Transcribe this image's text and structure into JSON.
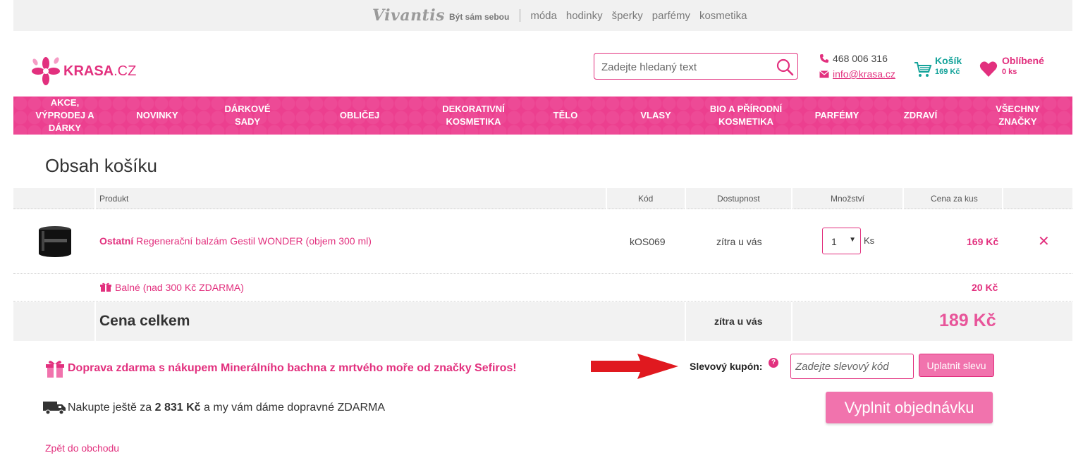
{
  "topbar": {
    "brand": "Vivantis",
    "slogan": "Být sám sebou",
    "links": [
      "móda",
      "hodinky",
      "šperky",
      "parfémy",
      "kosmetika"
    ]
  },
  "header": {
    "logo_main": "KRASA",
    "logo_tld": ".CZ",
    "search_placeholder": "Zadejte hledaný text",
    "phone": "468 006 316",
    "email": "info@krasa.cz",
    "cart_label": "Košík",
    "cart_total": "169 Kč",
    "fav_label": "Oblíbené",
    "fav_count": "0 ks"
  },
  "nav": [
    "AKCE, VÝPRODEJ A DÁRKY",
    "NOVINKY",
    "DÁRKOVÉ SADY",
    "OBLIČEJ",
    "DEKORATIVNÍ KOSMETIKA",
    "TĚLO",
    "VLASY",
    "BIO A PŘÍRODNÍ KOSMETIKA",
    "PARFÉMY",
    "ZDRAVÍ",
    "VŠECHNY ZNAČKY"
  ],
  "page_title": "Obsah košíku",
  "table": {
    "headers": {
      "product": "Produkt",
      "code": "Kód",
      "availability": "Dostupnost",
      "quantity": "Množství",
      "unit_price": "Cena za kus"
    },
    "item": {
      "brand": "Ostatní",
      "name": "Regenerační balzám Gestil WONDER (objem 300 ml)",
      "code": "kOS069",
      "availability": "zítra u vás",
      "quantity": "1",
      "unit": "Ks",
      "price": "169 Kč"
    },
    "packaging": {
      "label": "Balné (nad 300 Kč ZDARMA)",
      "price": "20 Kč"
    },
    "total": {
      "label": "Cena celkem",
      "availability": "zítra u vás",
      "price": "189 Kč"
    }
  },
  "promo": "Doprava zdarma s nákupem Minerálního bachna z mrtvého moře od značky Sefiros!",
  "free_shipping": {
    "prefix": "Nakupte ještě za",
    "amount": "2 831 Kč",
    "suffix": "a my vám dáme dopravné ZDARMA"
  },
  "coupon": {
    "label": "Slevový kupón:",
    "help": "?",
    "placeholder": "Zadejte slevový kód",
    "button": "Uplatnit slevu"
  },
  "order_button": "Vyplnit objednávku",
  "back_link": "Zpět do obchodu",
  "colors": {
    "brand_pink": "#e2307e",
    "nav_pink": "#ec3f8f",
    "button_pink": "#f173ad",
    "cart_teal": "#14a39a",
    "arrow_red": "#e0191f"
  }
}
